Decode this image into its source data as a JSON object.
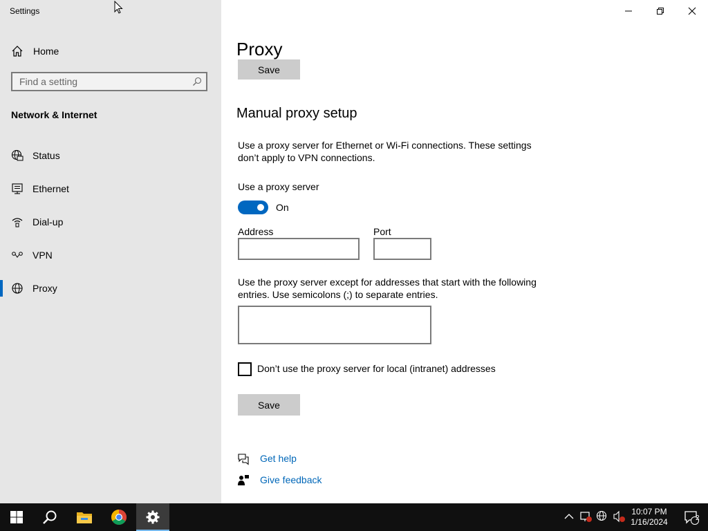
{
  "window": {
    "app_title": "Settings",
    "controls": [
      "minimize",
      "restore",
      "close"
    ]
  },
  "sidebar": {
    "home_label": "Home",
    "search_placeholder": "Find a setting",
    "section_heading": "Network & Internet",
    "items": [
      {
        "label": "Status",
        "icon": "globe-monitor-icon",
        "selected": false
      },
      {
        "label": "Ethernet",
        "icon": "ethernet-icon",
        "selected": false
      },
      {
        "label": "Dial-up",
        "icon": "dialup-icon",
        "selected": false
      },
      {
        "label": "VPN",
        "icon": "vpn-icon",
        "selected": false
      },
      {
        "label": "Proxy",
        "icon": "globe-icon",
        "selected": true
      }
    ]
  },
  "main": {
    "page_title": "Proxy",
    "top_save_label": "Save",
    "manual_heading": "Manual proxy setup",
    "manual_description": "Use a proxy server for Ethernet or Wi-Fi connections. These settings don’t apply to VPN connections.",
    "use_proxy_label": "Use a proxy server",
    "use_proxy_state": "On",
    "use_proxy_on": true,
    "address_label": "Address",
    "address_value": "",
    "port_label": "Port",
    "port_value": "",
    "exceptions_description": "Use the proxy server except for addresses that start with the following entries. Use semicolons (;) to separate entries.",
    "exceptions_value": "",
    "local_checkbox_label": "Don’t use the proxy server for local (intranet) addresses",
    "local_checkbox_checked": false,
    "save_label": "Save",
    "get_help_label": "Get help",
    "feedback_label": "Give feedback"
  },
  "taskbar": {
    "pinned": [
      "windows-start-icon",
      "search-icon",
      "file-explorer-icon",
      "chrome-icon",
      "settings-gear-icon"
    ],
    "active": "settings-gear-icon",
    "clock_time": "10:07 PM",
    "clock_date": "1/16/2024",
    "notification_count": "2"
  },
  "colors": {
    "accent": "#0067c0",
    "link": "#0067b8",
    "sidebar_bg": "#e6e6e6",
    "taskbar_bg": "#101010"
  }
}
